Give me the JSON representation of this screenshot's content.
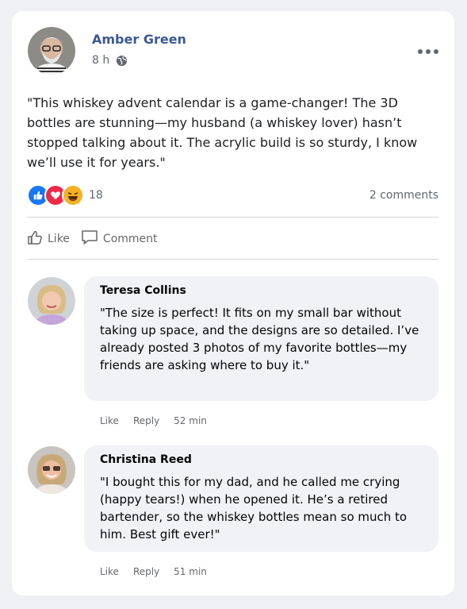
{
  "post": {
    "author": "Amber Green",
    "time": "8 h",
    "text": "\"This whiskey advent calendar is a game-changer! The 3D bottles are stunning—my husband (a whiskey lover) hasn’t stopped talking about it. The acrylic build is so sturdy, I know we’ll use it for years.\"",
    "reaction_count": "18",
    "comments_count": "2 comments",
    "like_label": "Like",
    "comment_label": "Comment"
  },
  "comments": [
    {
      "name": "Teresa Collins",
      "text": "\"The size is perfect! It fits on my small bar without taking up space, and the designs are so detailed. I’ve already posted 3 photos of my favorite bottles—my friends are asking where to buy it.\"",
      "like_label": "Like",
      "reply_label": "Reply",
      "time": "52 min"
    },
    {
      "name": "Christina Reed",
      "text": "\"I bought this for my dad, and he called me crying (happy tears!) when he opened it. He’s a retired bartender, so the whiskey bottles mean so much to him. Best gift ever!\"",
      "like_label": "Like",
      "reply_label": "Reply",
      "time": "51 min"
    }
  ],
  "icons": {
    "globe": "globe-icon",
    "more": "more-options-icon",
    "like_reaction": "like-reaction-icon",
    "love_reaction": "love-reaction-icon",
    "haha_reaction": "haha-reaction-icon",
    "thumbs_up": "thumbs-up-icon",
    "comment": "comment-icon"
  },
  "colors": {
    "author_name": "#3b5998",
    "like_blue": "#1877f2",
    "love_red": "#f02849",
    "haha_yellow": "#f7b125",
    "bubble_bg": "#f0f2f5"
  }
}
